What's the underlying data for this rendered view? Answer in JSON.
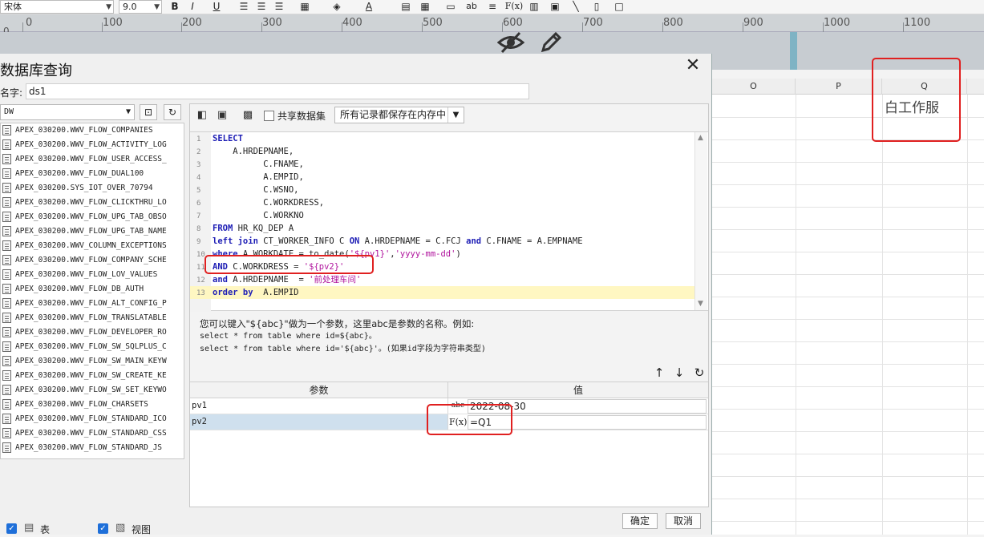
{
  "toolbar": {
    "font_name": "宋体",
    "font_size": "9.0",
    "bold": "B",
    "italic": "I",
    "underline": "U",
    "text_color": "A",
    "ab": "ab",
    "fx": "F(x)"
  },
  "ruler": {
    "zero": "0",
    "ticks": [
      "0",
      "100",
      "200",
      "300",
      "400",
      "500",
      "600",
      "700",
      "800",
      "900",
      "1000",
      "1100"
    ]
  },
  "sheet": {
    "columns": [
      "O",
      "P",
      "Q"
    ],
    "q1_value": "白工作服"
  },
  "dialog": {
    "title": "数据库查询",
    "name_label": "名字:",
    "name_value": "ds1",
    "datasource": "DW",
    "share_label": "共享数据集",
    "memory_option": "所有记录都保存在内存中",
    "tables": [
      "APEX_030200.WWV_FLOW_COMPANIES",
      "APEX_030200.WWV_FLOW_ACTIVITY_LOG",
      "APEX_030200.WWV_FLOW_USER_ACCESS_",
      "APEX_030200.WWV_FLOW_DUAL100",
      "APEX_030200.SYS_IOT_OVER_70794",
      "APEX_030200.WWV_FLOW_CLICKTHRU_LO",
      "APEX_030200.WWV_FLOW_UPG_TAB_OBSO",
      "APEX_030200.WWV_FLOW_UPG_TAB_NAME",
      "APEX_030200.WWV_COLUMN_EXCEPTIONS",
      "APEX_030200.WWV_FLOW_COMPANY_SCHE",
      "APEX_030200.WWV_FLOW_LOV_VALUES",
      "APEX_030200.WWV_FLOW_DB_AUTH",
      "APEX_030200.WWV_FLOW_ALT_CONFIG_P",
      "APEX_030200.WWV_FLOW_TRANSLATABLE",
      "APEX_030200.WWV_FLOW_DEVELOPER_RO",
      "APEX_030200.WWV_FLOW_SW_SQLPLUS_C",
      "APEX_030200.WWV_FLOW_SW_MAIN_KEYW",
      "APEX_030200.WWV_FLOW_SW_CREATE_KE",
      "APEX_030200.WWV_FLOW_SW_SET_KEYWO",
      "APEX_030200.WWV_FLOW_CHARSETS",
      "APEX_030200.WWV_FLOW_STANDARD_ICO",
      "APEX_030200.WWV_FLOW_STANDARD_CSS",
      "APEX_030200.WWV_FLOW_STANDARD_JS"
    ],
    "filter_table_label": "表",
    "filter_view_label": "视图",
    "sql_lines": [
      {
        "n": "1",
        "parts": [
          {
            "t": "SELECT",
            "c": "kw"
          }
        ]
      },
      {
        "n": "2",
        "parts": [
          {
            "t": "    A.HRDEPNAME,",
            "c": ""
          }
        ]
      },
      {
        "n": "3",
        "parts": [
          {
            "t": "          C.FNAME,",
            "c": ""
          }
        ]
      },
      {
        "n": "4",
        "parts": [
          {
            "t": "          A.EMPID,",
            "c": ""
          }
        ]
      },
      {
        "n": "5",
        "parts": [
          {
            "t": "          C.WSNO,",
            "c": ""
          }
        ]
      },
      {
        "n": "6",
        "parts": [
          {
            "t": "          C.WORKDRESS,",
            "c": ""
          }
        ]
      },
      {
        "n": "7",
        "parts": [
          {
            "t": "          C.WORKNO",
            "c": ""
          }
        ]
      },
      {
        "n": "8",
        "parts": [
          {
            "t": "FROM",
            "c": "kw"
          },
          {
            "t": " HR_KQ_DEP A",
            "c": ""
          }
        ]
      },
      {
        "n": "9",
        "parts": [
          {
            "t": "left join",
            "c": "kw"
          },
          {
            "t": " CT_WORKER_INFO C ",
            "c": ""
          },
          {
            "t": "ON",
            "c": "kw"
          },
          {
            "t": " A.HRDEPNAME = C.FCJ ",
            "c": ""
          },
          {
            "t": "and",
            "c": "kw"
          },
          {
            "t": " C.FNAME = A.EMPNAME",
            "c": ""
          }
        ]
      },
      {
        "n": "10",
        "parts": [
          {
            "t": "where",
            "c": "kw"
          },
          {
            "t": " A.WORKDATE = to_date(",
            "c": ""
          },
          {
            "t": "'${pv1}'",
            "c": "str"
          },
          {
            "t": ",",
            "c": ""
          },
          {
            "t": "'yyyy-mm-dd'",
            "c": "str"
          },
          {
            "t": ")",
            "c": ""
          }
        ]
      },
      {
        "n": "11",
        "parts": [
          {
            "t": "AND",
            "c": "kw"
          },
          {
            "t": " C.WORKDRESS = ",
            "c": ""
          },
          {
            "t": "'${pv2}'",
            "c": "str"
          }
        ]
      },
      {
        "n": "12",
        "parts": [
          {
            "t": "and",
            "c": "kw"
          },
          {
            "t": " A.HRDEPNAME  = ",
            "c": ""
          },
          {
            "t": "'前处理车间'",
            "c": "str"
          }
        ]
      },
      {
        "n": "13",
        "parts": [
          {
            "t": "order by",
            "c": "kw"
          },
          {
            "t": "  A.EMPID",
            "c": ""
          }
        ]
      }
    ],
    "hint_line1": "您可以键入\"${abc}\"做为一个参数，这里abc是参数的名称。例如:",
    "hint_line2": "select * from table where id=${abc}。",
    "hint_line3": "select * from table where id='${abc}'。(如果id字段为字符串类型)",
    "param_header": "参数",
    "value_header": "值",
    "params": [
      {
        "name": "pv1",
        "value": "2022-08-30",
        "icon": "abc"
      },
      {
        "name": "pv2",
        "value": "=Q1",
        "icon": "F(x)"
      }
    ],
    "ok_label": "确定",
    "cancel_label": "取消"
  },
  "colors": {
    "highlight": "#e02020",
    "keyword": "#1d1db5",
    "string": "#b0149d",
    "checkbox": "#1e6fd9"
  }
}
